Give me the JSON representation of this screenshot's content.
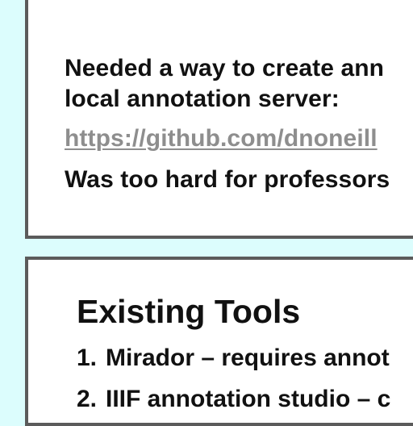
{
  "top_slide": {
    "line1": "Needed a way to create ann",
    "line2": "local annotation server:",
    "link": "https://github.com/dnoneill",
    "line4": "Was too hard for professors"
  },
  "bottom_slide": {
    "heading": "Existing Tools",
    "items": [
      {
        "number": "1.",
        "text": "Mirador – requires annot"
      },
      {
        "number": "2.",
        "text": "IIIF annotation studio – c"
      }
    ]
  },
  "colors": {
    "background": "#dcfdfd",
    "slide_border": "#5b5b5b",
    "link_text": "#8e8e8e"
  }
}
